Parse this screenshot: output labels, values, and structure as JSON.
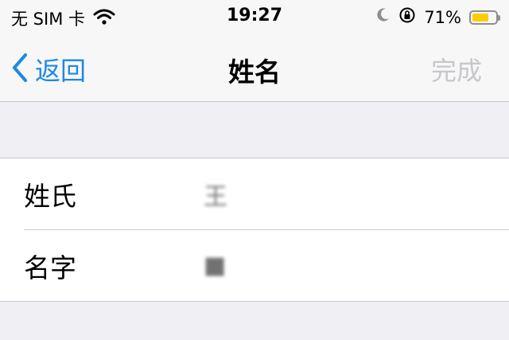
{
  "status_bar": {
    "carrier": "无 SIM 卡",
    "time": "19:27",
    "battery": "71%",
    "battery_level": 0.71,
    "icons": [
      "wifi-icon",
      "moon-icon",
      "orientation-lock-icon",
      "battery-icon"
    ]
  },
  "nav": {
    "back_label": "返回",
    "title": "姓名",
    "done_label": "完成"
  },
  "fields": [
    {
      "label": "姓氏",
      "value": "王"
    },
    {
      "label": "名字",
      "value": "■"
    }
  ],
  "colors": {
    "accent": "#1e88e5",
    "disabled": "#c7c7cc",
    "battery": "#ffcc00",
    "background": "#efeff4"
  }
}
